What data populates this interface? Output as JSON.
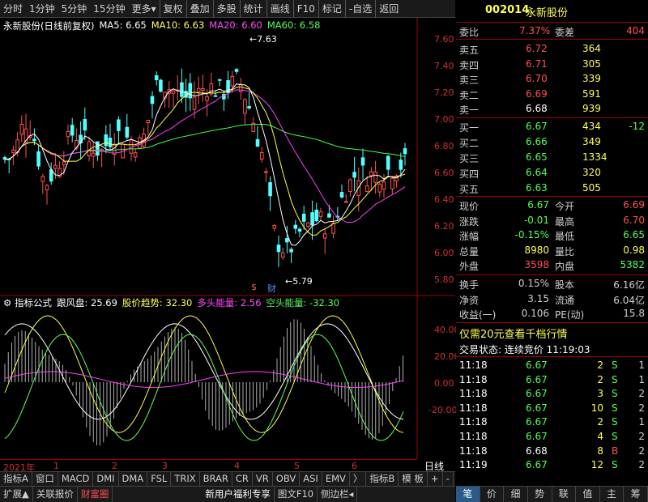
{
  "toolbar": {
    "items": [
      "分时",
      "1分钟",
      "5分钟",
      "15分钟",
      "更多",
      "复权",
      "叠加",
      "多股",
      "统计",
      "画线",
      "F10",
      "标记",
      "-自选",
      "返回"
    ],
    "more_arrow": "▾"
  },
  "stock": {
    "code": "002014",
    "name": "永新股份"
  },
  "chart_title": {
    "name": "永新股份(日线前复权)",
    "ma5": "MA5: 6.65",
    "ma10": "MA10: 6.63",
    "ma20": "MA20: 6.60",
    "ma60": "MA60: 6.58"
  },
  "y_ticks": [
    "7.60",
    "7.40",
    "7.20",
    "7.00",
    "6.80",
    "6.60",
    "6.40",
    "6.20",
    "6.00",
    "5.80"
  ],
  "annotations": {
    "high": "7.63",
    "low": "5.79",
    "fin_label": "财"
  },
  "indicator": {
    "title": "指标公式",
    "name": "跟风盘: 25.69",
    "l2": "股价趋势: 32.30",
    "l3": "多头能量: 2.56",
    "l4": "空头能量: -32.30"
  },
  "ind_ticks": [
    "40.00",
    "20.00",
    "0.00",
    "-20.00"
  ],
  "date_axis": [
    "2021年",
    "1",
    "2",
    "3",
    "4",
    "5",
    "6"
  ],
  "period_label": "日线",
  "tabs1": [
    "指标A",
    "窗口",
    "MACD",
    "DMI",
    "DMA",
    "FSL",
    "TRIX",
    "BRAR",
    "CR",
    "VR",
    "OBV",
    "ASI",
    "EMV",
    "〉",
    "指标B",
    "模 板",
    "+",
    "-"
  ],
  "tabs2": [
    "扩展▲",
    "关联报价",
    "财富圈",
    "新用户福利专享",
    "图文F10",
    "侧边栏◂"
  ],
  "quote": {
    "weibi_label": "委比",
    "weibi": "7.37%",
    "weicha_label": "委差",
    "weicha": "404",
    "asks": [
      {
        "label": "卖五",
        "price": "6.72",
        "vol": "364"
      },
      {
        "label": "卖四",
        "price": "6.71",
        "vol": "305"
      },
      {
        "label": "卖三",
        "price": "6.70",
        "vol": "339"
      },
      {
        "label": "卖二",
        "price": "6.69",
        "vol": "591"
      },
      {
        "label": "卖一",
        "price": "6.68",
        "vol": "939"
      }
    ],
    "bids": [
      {
        "label": "买一",
        "price": "6.67",
        "vol": "434",
        "chg": "-12"
      },
      {
        "label": "买二",
        "price": "6.66",
        "vol": "349",
        "chg": ""
      },
      {
        "label": "买三",
        "price": "6.65",
        "vol": "1334",
        "chg": ""
      },
      {
        "label": "买四",
        "price": "6.64",
        "vol": "320",
        "chg": ""
      },
      {
        "label": "买五",
        "price": "6.63",
        "vol": "505",
        "chg": ""
      }
    ],
    "stats": [
      {
        "l1": "现价",
        "v1": "6.67",
        "l2": "今开",
        "v2": "6.69"
      },
      {
        "l1": "涨跌",
        "v1": "-0.01",
        "l2": "最高",
        "v2": "6.70"
      },
      {
        "l1": "涨幅",
        "v1": "-0.15%",
        "l2": "最低",
        "v2": "6.65"
      },
      {
        "l1": "总量",
        "v1": "8980",
        "l2": "量比",
        "v2": "0.98"
      },
      {
        "l1": "外盘",
        "v1": "3598",
        "l2": "内盘",
        "v2": "5382"
      }
    ],
    "stats2": [
      {
        "l1": "换手",
        "v1": "0.15%",
        "l2": "股本",
        "v2": "6.16亿"
      },
      {
        "l1": "净资",
        "v1": "3.15",
        "l2": "流通",
        "v2": "6.04亿"
      },
      {
        "l1": "收益(一)",
        "v1": "0.106",
        "l2": "PE(动)",
        "v2": "15.8"
      }
    ],
    "promo": "仅需20元查看千档行情",
    "status": "交易状态: 连续竞价 11:19:03",
    "ticks": [
      {
        "t": "11:18",
        "p": "6.67",
        "v": "2",
        "d": "S",
        "n": "1"
      },
      {
        "t": "11:18",
        "p": "6.67",
        "v": "2",
        "d": "S",
        "n": "1"
      },
      {
        "t": "11:18",
        "p": "6.67",
        "v": "3",
        "d": "S",
        "n": "2"
      },
      {
        "t": "11:18",
        "p": "6.67",
        "v": "10",
        "d": "S",
        "n": "2"
      },
      {
        "t": "11:18",
        "p": "6.67",
        "v": "2",
        "d": "S",
        "n": "1"
      },
      {
        "t": "11:18",
        "p": "6.67",
        "v": "4",
        "d": "S",
        "n": "2"
      },
      {
        "t": "11:18",
        "p": "6.68",
        "v": "8",
        "d": "B",
        "n": "2"
      },
      {
        "t": "11:19",
        "p": "6.67",
        "v": "12",
        "d": "S",
        "n": "2"
      }
    ],
    "bottom_tabs": [
      "笔",
      "价",
      "细",
      "势",
      "联",
      "值",
      "主",
      "筹"
    ]
  }
}
